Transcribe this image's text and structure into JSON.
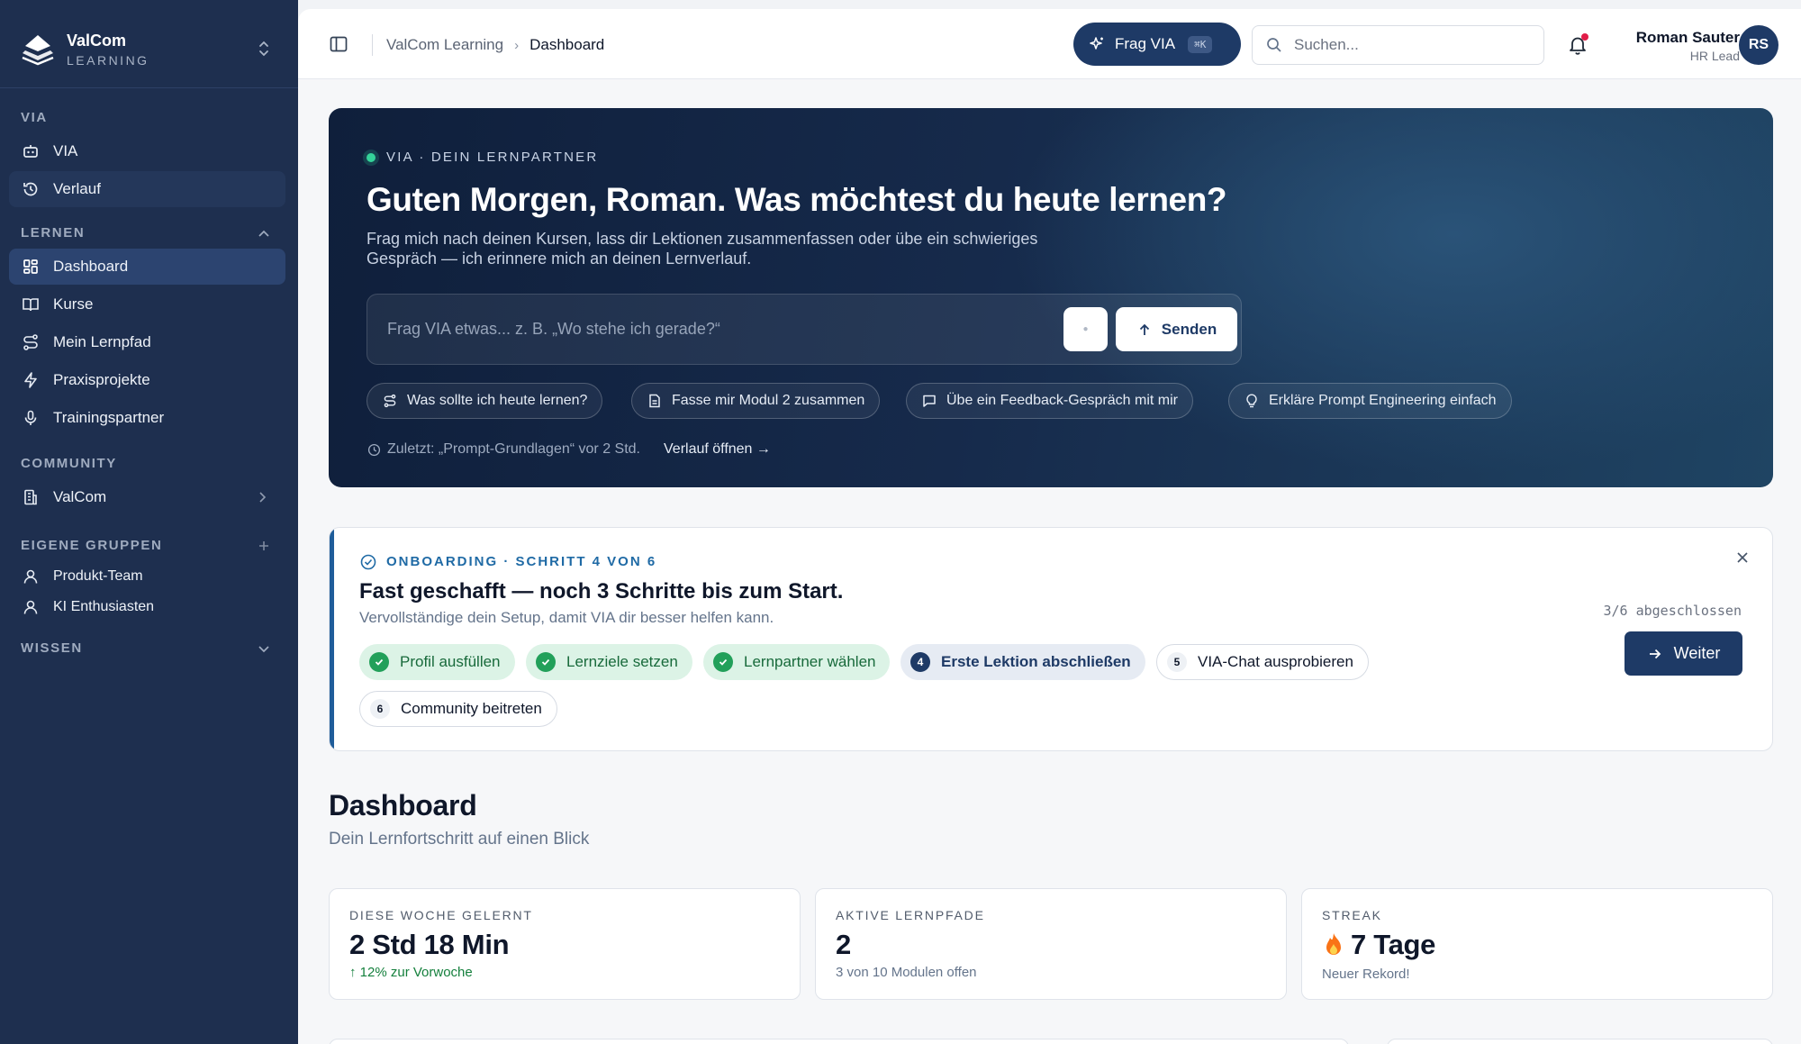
{
  "brand": {
    "name": "ValCom",
    "sub": "LEARNING"
  },
  "sidebar": {
    "sections": {
      "via": "VIA",
      "lernen": "LERNEN",
      "community": "COMMUNITY",
      "gruppen": "EIGENE GRUPPEN",
      "wissen": "WISSEN"
    },
    "items": {
      "via": "VIA",
      "verlauf": "Verlauf",
      "dashboard": "Dashboard",
      "kurse": "Kurse",
      "lernpfad": "Mein Lernpfad",
      "praxis": "Praxisprojekte",
      "training": "Trainingspartner",
      "valcom": "ValCom",
      "produkt": "Produkt-Team",
      "ki": "KI Enthusiasten"
    }
  },
  "topbar": {
    "breadcrumb_root": "ValCom Learning",
    "breadcrumb_current": "Dashboard",
    "ask_label": "Frag VIA",
    "ask_shortcut": "⌘K",
    "search_placeholder": "Suchen...",
    "user_name": "Roman Sauter",
    "user_role": "HR Lead",
    "user_initials": "RS"
  },
  "hero": {
    "kicker": "VIA · DEIN LERNPARTNER",
    "title": "Guten Morgen, Roman. Was möchtest du heute lernen?",
    "subtitle": "Frag mich nach deinen Kursen, lass dir Lektionen zusammenfassen oder übe ein schwieriges Gespräch — ich erinnere mich an deinen Lernverlauf.",
    "input_placeholder": "Frag VIA etwas... z. B. „Wo stehe ich gerade?“",
    "send_label": "Senden",
    "chips": [
      "Was sollte ich heute lernen?",
      "Fasse mir Modul 2 zusammen",
      "Übe ein Feedback-Gespräch mit mir",
      "Erkläre Prompt Engineering einfach"
    ],
    "recent": "Zuletzt: „Prompt-Grundlagen“ vor 2 Std.",
    "history_link": "Verlauf öffnen →"
  },
  "onboarding": {
    "kicker": "ONBOARDING · SCHRITT 4 VON 6",
    "title": "Fast geschafft — noch 3 Schritte bis zum Start.",
    "subtitle": "Vervollständige dein Setup, damit VIA dir besser helfen kann.",
    "progress": "3/6 abgeschlossen",
    "progress_fraction": 0.5,
    "button": "Weiter",
    "steps": [
      {
        "label": "Profil ausfüllen",
        "state": "done"
      },
      {
        "label": "Lernziele setzen",
        "state": "done"
      },
      {
        "label": "Lernpartner wählen",
        "state": "done"
      },
      {
        "label": "Erste Lektion abschließen",
        "state": "current",
        "num": "4"
      },
      {
        "label": "VIA-Chat ausprobieren",
        "state": "todo",
        "num": "5"
      },
      {
        "label": "Community beitreten",
        "state": "todo",
        "num": "6"
      }
    ]
  },
  "dashboard": {
    "title": "Dashboard",
    "subtitle": "Dein Lernfortschritt auf einen Blick",
    "stats": [
      {
        "label": "DIESE WOCHE GELERNT",
        "value": "2 Std 18 Min",
        "note": "↑ 12% zur Vorwoche"
      },
      {
        "label": "AKTIVE LERNPFADE",
        "value": "2",
        "note": "3 von 10 Modulen offen"
      },
      {
        "label": "STREAK",
        "value": "7 Tage",
        "note": "Neuer Rekord!"
      }
    ]
  },
  "colors": {
    "sidebar": "#1e2f4f",
    "accent": "#1e3a66",
    "onboarding_accent": "#1f6aa5",
    "success": "#22a05a",
    "notification": "#e11d48"
  }
}
